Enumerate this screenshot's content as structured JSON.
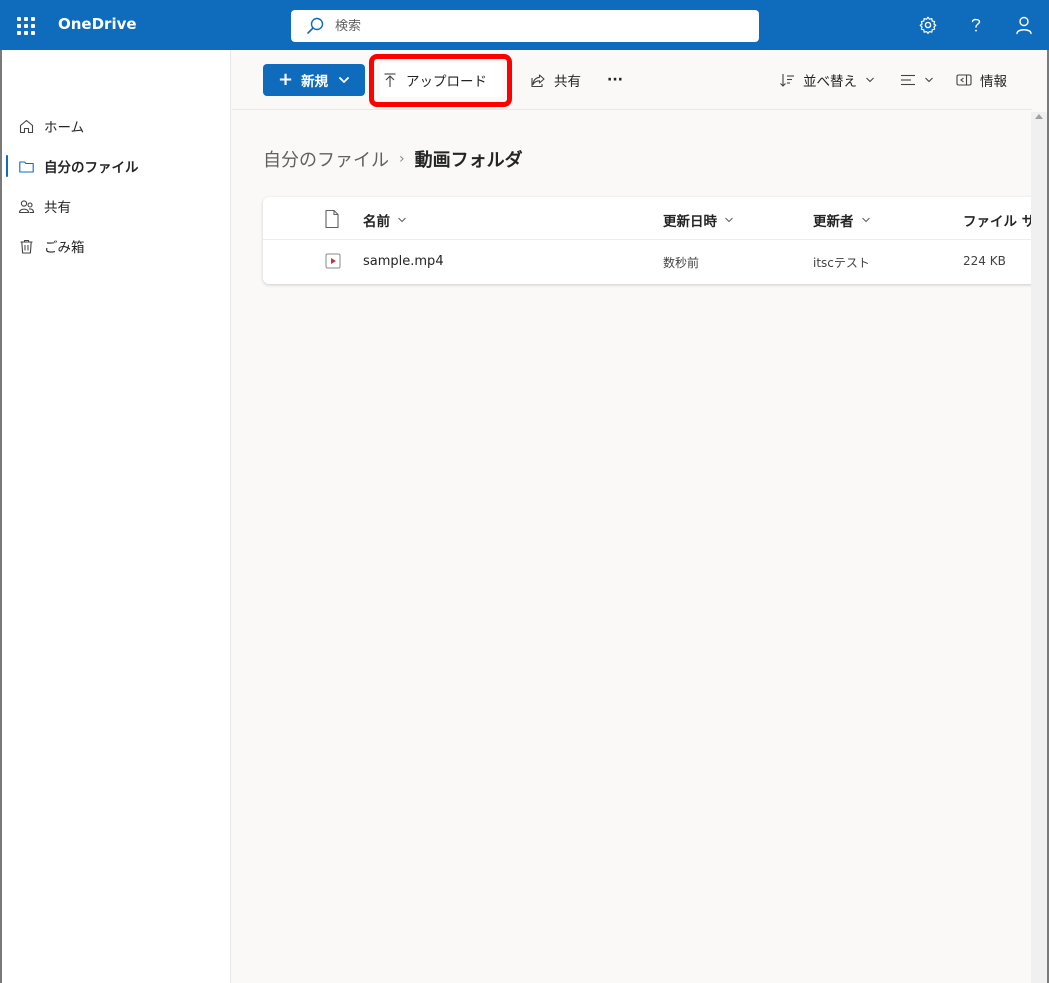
{
  "app": {
    "title": "OneDrive"
  },
  "search": {
    "placeholder": "検索"
  },
  "sidebar": {
    "items": [
      {
        "label": "ホーム",
        "icon": "home-icon"
      },
      {
        "label": "自分のファイル",
        "icon": "folder-icon",
        "active": true
      },
      {
        "label": "共有",
        "icon": "people-icon"
      },
      {
        "label": "ごみ箱",
        "icon": "trash-icon"
      }
    ]
  },
  "toolbar": {
    "new_label": "新規",
    "upload_label": "アップロード",
    "share_label": "共有",
    "more_label": "···",
    "sort_label": "並べ替え",
    "info_label": "情報"
  },
  "breadcrumb": {
    "parent": "自分のファイル",
    "separator": "›",
    "current": "動画フォルダ"
  },
  "table": {
    "columns": {
      "name": "名前",
      "modified": "更新日時",
      "modified_by": "更新者",
      "size": "ファイル サイズ"
    },
    "rows": [
      {
        "name": "sample.mp4",
        "modified": "数秒前",
        "modified_by": "itscテスト",
        "size": "224 KB"
      }
    ]
  },
  "colors": {
    "accent": "#0f6cbd",
    "highlight": "#ff0000"
  }
}
